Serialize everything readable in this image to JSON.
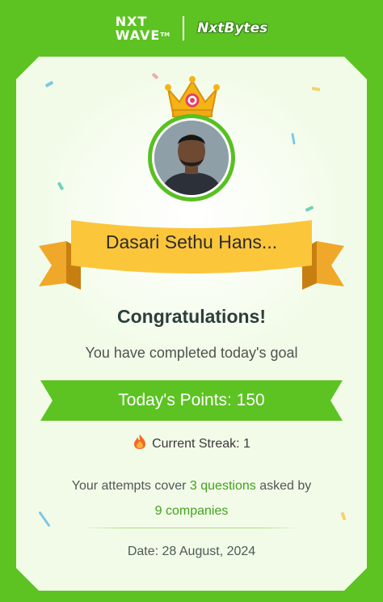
{
  "brand": {
    "logo_line1": "NXT",
    "logo_line2": "WAVE",
    "logo_tm": "TM",
    "partner_logo": "NxtBytes"
  },
  "card": {
    "user_name": "Dasari Sethu Hans...",
    "heading": "Congratulations!",
    "subtitle": "You have completed today's goal",
    "points_label": "Today's Points: 150",
    "streak": {
      "icon": "fire-icon",
      "label": "Current Streak: 1"
    },
    "attempts": {
      "prefix": "Your attempts cover",
      "questions": "3 questions",
      "middle": "asked by",
      "companies": "9 companies"
    },
    "date_label": "Date:",
    "date_value": "28 August, 2024"
  },
  "colors": {
    "brand_green": "#5cc322",
    "card_bg": "#f2fbe8",
    "ribbon_yellow": "#fcc63b",
    "crown_gold": "#f5b317"
  }
}
